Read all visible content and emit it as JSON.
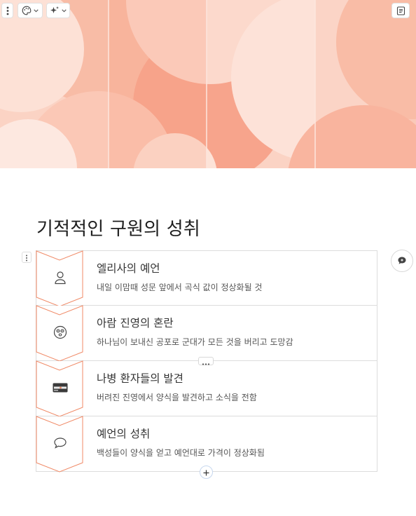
{
  "toolbar": {
    "menu_icon": "vertical-dots-icon",
    "theme_icon": "palette-icon",
    "ai_icon": "sparkles-icon",
    "page_icon": "document-icon"
  },
  "cover": {
    "colors": [
      "#fbd3c4",
      "#f7a48c",
      "#fde3d8",
      "#f5987b"
    ]
  },
  "page": {
    "title": "기적적인 구원의 성취"
  },
  "steps": [
    {
      "title": "엘리사의 예언",
      "description": "내일 이맘때 성문 앞에서 곡식 값이 정상화될 것",
      "icon": "person-icon"
    },
    {
      "title": "아람 진영의 혼란",
      "description": "하나님이 보내신 공포로 군대가 모든 것을 버리고 도망감",
      "icon": "frightened-face-icon"
    },
    {
      "title": "나병 환자들의 발견",
      "description": "버려진 진영에서 양식을 발견하고 소식을 전함",
      "icon": "discover-card-icon"
    },
    {
      "title": "예언의 성취",
      "description": "백성들이 양식을 얻고 예언대로 가격이 정상화됨",
      "icon": "speech-bubble-icon"
    }
  ],
  "accent_color": "#f08a67"
}
